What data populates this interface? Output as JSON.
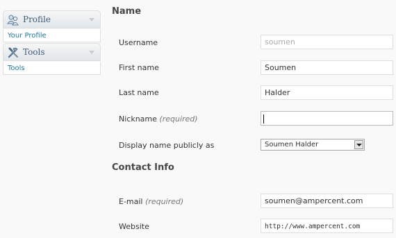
{
  "sidebar": {
    "groups": [
      {
        "title": "Profile",
        "icon": "users-icon",
        "items": [
          {
            "label": "Your Profile"
          }
        ]
      },
      {
        "title": "Tools",
        "icon": "tools-icon",
        "items": [
          {
            "label": "Tools"
          }
        ]
      }
    ]
  },
  "name_section": {
    "title": "Name",
    "username": {
      "label": "Username",
      "value": "soumen"
    },
    "first_name": {
      "label": "First name",
      "value": "Soumen"
    },
    "last_name": {
      "label": "Last name",
      "value": "Halder"
    },
    "nickname": {
      "label": "Nickname",
      "required": "(required)",
      "value": ""
    },
    "display_name": {
      "label": "Display name publicly as",
      "selected": "Soumen Halder"
    }
  },
  "contact_section": {
    "title": "Contact Info",
    "email": {
      "label": "E-mail",
      "required": "(required)",
      "value": "soumen@ampercent.com"
    },
    "website": {
      "label": "Website",
      "value": "http://www.ampercent.com"
    }
  }
}
